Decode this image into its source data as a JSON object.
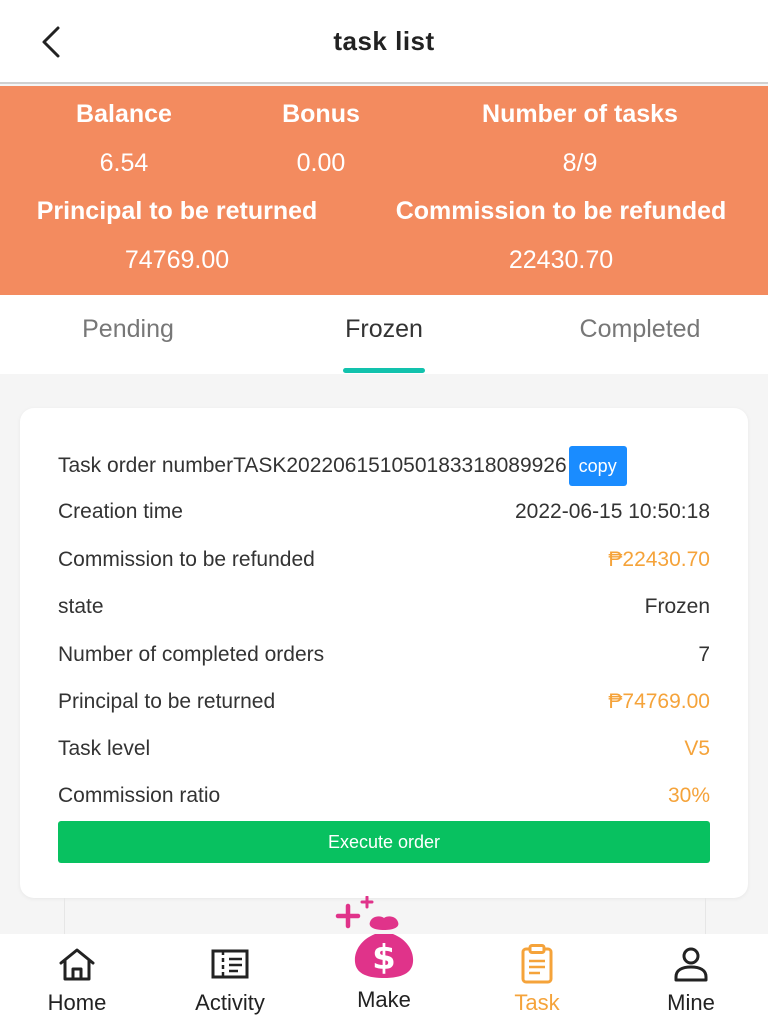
{
  "header": {
    "title": "task list"
  },
  "stats": {
    "balance_label": "Balance",
    "balance_value": "6.54",
    "bonus_label": "Bonus",
    "bonus_value": "0.00",
    "tasks_label": "Number of tasks",
    "tasks_value": "8/9",
    "principal_label": "Principal to be returned",
    "principal_value": "74769.00",
    "commission_label": "Commission to be refunded",
    "commission_value": "22430.70"
  },
  "tabs": [
    "Pending",
    "Frozen",
    "Completed"
  ],
  "active_tab": "Frozen",
  "order": {
    "number_label": "Task order number",
    "number_value": "TASK20220615105018331808992​6",
    "copy_label": "copy",
    "rows": [
      {
        "label": "Creation time",
        "value": "2022-06-15 10:50:18"
      },
      {
        "label": "Commission to be refunded",
        "value": "₱22430.70"
      },
      {
        "label": "state",
        "value": "Frozen"
      },
      {
        "label": "Number of completed orders",
        "value": "7"
      },
      {
        "label": "Principal to be returned",
        "value": "₱74769.00"
      },
      {
        "label": "Task level",
        "value": "V5"
      },
      {
        "label": "Commission ratio",
        "value": "30%"
      }
    ],
    "execute_label": "Execute order"
  },
  "tabbar": {
    "items": [
      {
        "label": "Home",
        "icon": "home-icon"
      },
      {
        "label": "Activity",
        "icon": "ticket-icon"
      },
      {
        "label": "Make",
        "icon": "money-bag-icon"
      },
      {
        "label": "Task",
        "icon": "clipboard-icon"
      },
      {
        "label": "Mine",
        "icon": "user-icon"
      }
    ],
    "active": "Task"
  },
  "colors": {
    "stats_bg": "#f38b5f",
    "accent_orange": "#f5a33a",
    "tab_indicator": "#12c2ad",
    "execute_green": "#08c160",
    "copy_blue": "#1a8cff",
    "make_pink": "#e0338a"
  }
}
